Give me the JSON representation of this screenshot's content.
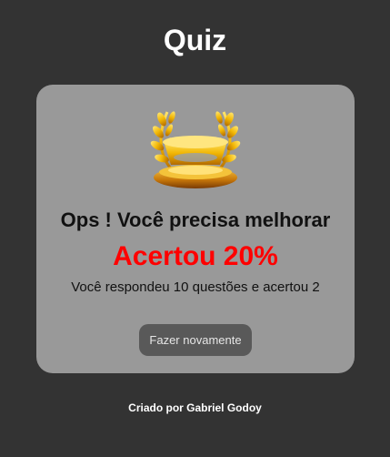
{
  "header": {
    "title": "Quiz"
  },
  "result": {
    "trophy_icon": "laurel-trophy-icon",
    "headline": "Ops ! Você precisa melhorar",
    "score_text": "Acertou 20%",
    "score_percent": 20,
    "score_color": "#ff0000",
    "detail": "Você respondeu 10 questões e acertou 2",
    "retry_label": "Fazer novamente"
  },
  "footer": {
    "credit": "Criado por Gabriel Godoy"
  }
}
